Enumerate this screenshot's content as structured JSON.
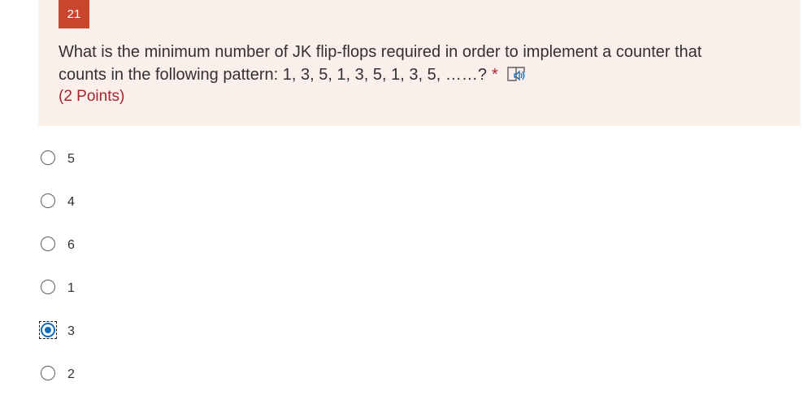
{
  "question": {
    "number": "21",
    "text_line1": "What is the minimum number of JK flip-flops required in order to implement a counter that",
    "text_line2": "counts in the following pattern: 1, 3, 5, 1, 3, 5, 1, 3, 5, ……?",
    "required_marker": "*",
    "points": "(2 Points)",
    "reader_icon": "immersive-reader-icon"
  },
  "options": [
    {
      "label": "5",
      "selected": false
    },
    {
      "label": "4",
      "selected": false
    },
    {
      "label": "6",
      "selected": false
    },
    {
      "label": "1",
      "selected": false
    },
    {
      "label": "3",
      "selected": true
    },
    {
      "label": "2",
      "selected": false
    }
  ],
  "colors": {
    "card_background": "#fbefec",
    "number_badge": "#c8462e",
    "points_text": "#a4262c",
    "radio_selected": "#0f6cbd"
  }
}
